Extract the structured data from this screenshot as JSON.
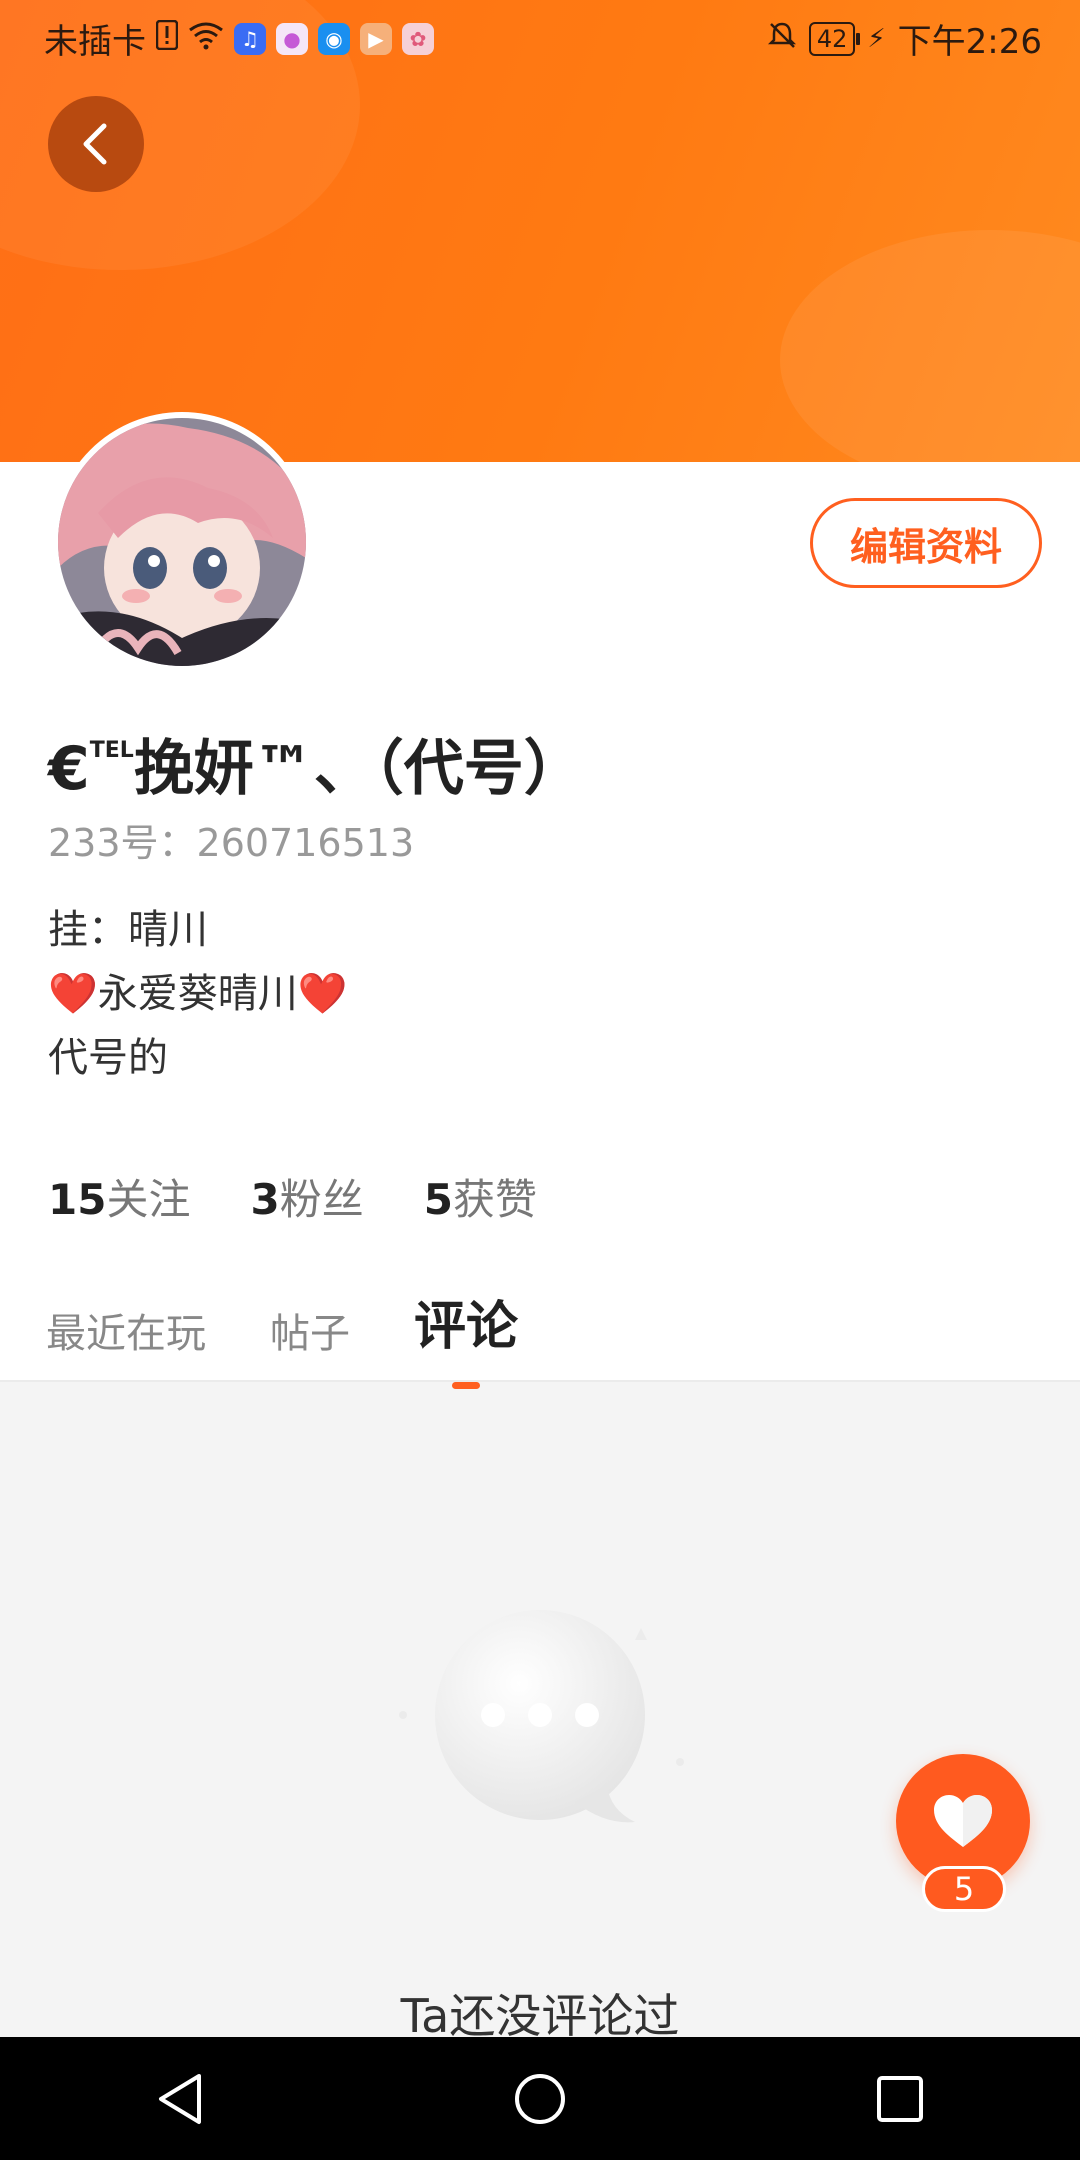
{
  "status_bar": {
    "carrier": "未插卡",
    "battery": "42",
    "time": "下午2:26"
  },
  "profile": {
    "nickname_pre": "€",
    "nickname_sup": "TEL",
    "nickname_post": "挽妍™、（代号）",
    "user_id": "233号：260716513",
    "bio": [
      "挂：晴川",
      "❤️永爱葵晴川❤️",
      "代号的"
    ],
    "edit_button": "编辑资料"
  },
  "stats": [
    {
      "count": "15",
      "label": "关注"
    },
    {
      "count": "3",
      "label": "粉丝"
    },
    {
      "count": "5",
      "label": "获赞"
    }
  ],
  "tabs": [
    {
      "label": "最近在玩",
      "active": false
    },
    {
      "label": "帖子",
      "active": false
    },
    {
      "label": "评论",
      "active": true
    }
  ],
  "empty_state": {
    "text": "Ta还没评论过"
  },
  "like_fab": {
    "count": "5"
  },
  "colors": {
    "accent": "#ff5f1f",
    "header": "#ff7a12"
  },
  "icons": [
    "back-icon",
    "heart-icon",
    "nav-back-icon",
    "nav-home-icon",
    "nav-recents-icon",
    "chat-bubble-icon"
  ]
}
